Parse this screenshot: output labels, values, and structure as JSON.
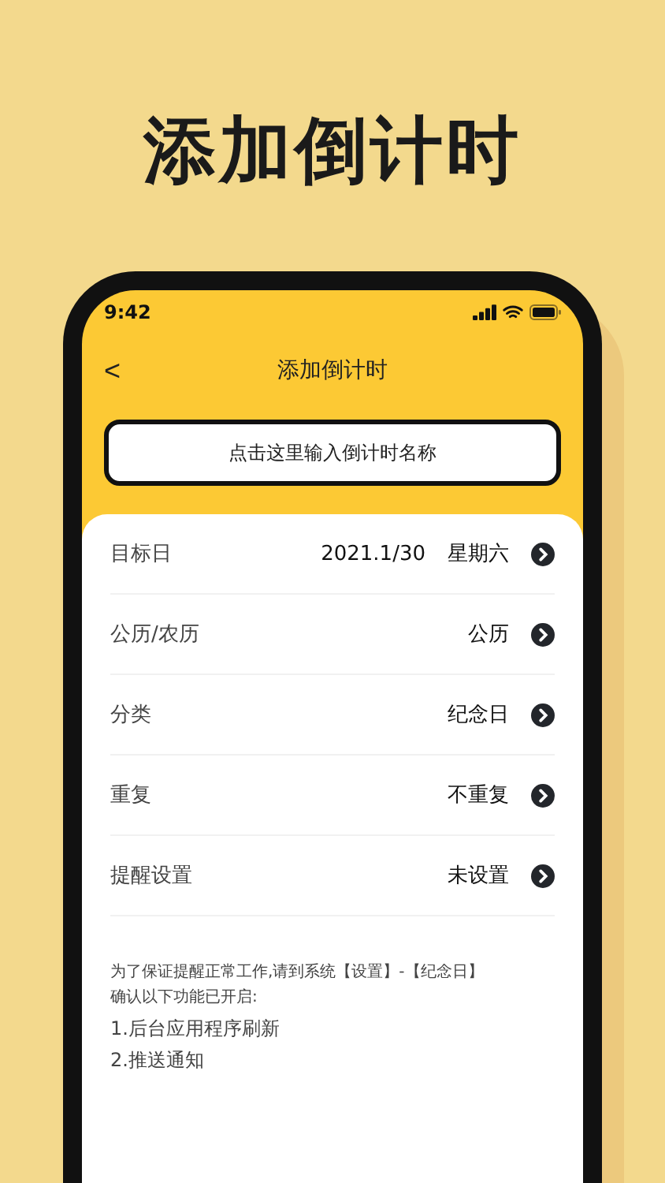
{
  "headline": "添加倒计时",
  "status_bar": {
    "time": "9:42"
  },
  "nav": {
    "back": "<",
    "title": "添加倒计时"
  },
  "name_field": {
    "placeholder": "点击这里输入倒计时名称"
  },
  "settings": [
    {
      "label": "目标日",
      "values": [
        "2021.1/30",
        "星期六"
      ]
    },
    {
      "label": "公历/农历",
      "values": [
        "公历"
      ]
    },
    {
      "label": "分类",
      "values": [
        "纪念日"
      ]
    },
    {
      "label": "重复",
      "values": [
        "不重复"
      ]
    },
    {
      "label": "提醒设置",
      "values": [
        "未设置"
      ]
    }
  ],
  "notice": {
    "lines": [
      "为了保证提醒正常工作,请到系统【设置】-【纪念日】",
      "确认以下功能已开启:"
    ],
    "items": [
      "1.后台应用程序刷新",
      "2.推送通知"
    ]
  }
}
